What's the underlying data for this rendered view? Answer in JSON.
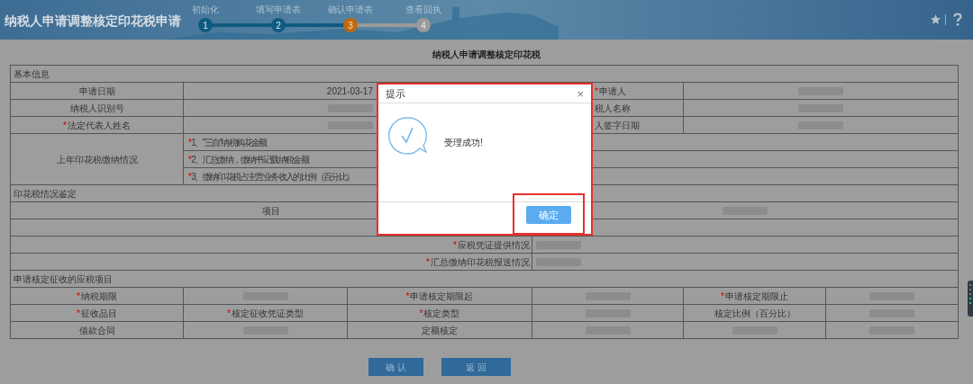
{
  "header": {
    "title": "纳税人申请调整核定印花税申请",
    "steps": [
      {
        "label": "初始化",
        "number": "1",
        "completed": true,
        "selected": false
      },
      {
        "label": "填写申请表",
        "number": "2",
        "completed": true,
        "selected": false
      },
      {
        "label": "确认申请表",
        "number": "3",
        "completed": false,
        "selected": true
      },
      {
        "label": "查看回执",
        "number": "4",
        "completed": false,
        "selected": false
      }
    ]
  },
  "form_title": "纳税人申请调整核定印花税",
  "basic_info": {
    "title": "基本信息",
    "rows": [
      [
        {
          "kind": "label",
          "text": "申请日期"
        },
        {
          "kind": "text",
          "text": "2021-03-17"
        },
        {
          "kind": "label",
          "text": "申请人",
          "marker": "*"
        },
        {
          "kind": "blur"
        }
      ],
      [
        {
          "kind": "label",
          "text": "纳税人识别号"
        },
        {
          "kind": "blur"
        },
        {
          "kind": "label",
          "text": "税人名称"
        },
        {
          "kind": "blur"
        }
      ],
      [
        {
          "kind": "label",
          "text": "法定代表人姓名",
          "marker": "*"
        },
        {
          "kind": "blur"
        },
        {
          "kind": "label",
          "text": "人签字日期"
        },
        {
          "kind": "blur"
        }
      ]
    ],
    "last_year": {
      "label": "上年印花税缴纳情况",
      "items": [
        {
          "text": "1、\"三自\"纳税购花金额",
          "marker": "*"
        },
        {
          "text": "2、汇总缴纳，缴纳书记载纳税金额",
          "marker": "*"
        },
        {
          "text": "3、缴纳印花税占主营业务收入的比例（百分比）",
          "marker": "*"
        }
      ]
    }
  },
  "stamp_tax": {
    "title": "印花税情况鉴定",
    "rows": [
      [
        {
          "kind": "header",
          "text": "项目"
        },
        {
          "kind": "blur"
        }
      ],
      [
        {
          "kind": "empty"
        },
        {
          "kind": "empty"
        }
      ],
      [
        {
          "kind": "label",
          "text": "应税凭证提供情况",
          "marker": "*"
        },
        {
          "kind": "blur"
        }
      ],
      [
        {
          "kind": "label",
          "text": "汇总缴纳印花税报送情况",
          "marker": "*"
        },
        {
          "kind": "blur"
        }
      ]
    ]
  },
  "items": {
    "title": "申请核定征收的应税项目",
    "rows": [
      [
        {
          "kind": "label",
          "text": "纳税期限",
          "marker": "*"
        },
        {
          "kind": "blur"
        },
        {
          "kind": "label",
          "text": "申请核定期限起",
          "marker": "*"
        },
        {
          "kind": "blur"
        },
        {
          "kind": "label",
          "text": "申请核定期限止",
          "marker": "*"
        },
        {
          "kind": "blur"
        }
      ],
      [
        {
          "kind": "label",
          "text": "征收品目",
          "marker": "*"
        },
        {
          "kind": "label",
          "text": "核定征收凭证类型",
          "marker": "*"
        },
        {
          "kind": "label",
          "text": "核定类型",
          "marker": "*"
        },
        {
          "kind": "blur"
        },
        {
          "kind": "label",
          "text": "核定比例（百分比）"
        },
        {
          "kind": "blur"
        }
      ],
      [
        {
          "kind": "label",
          "text": "借款合同"
        },
        {
          "kind": "blur"
        },
        {
          "kind": "label",
          "text": "定额核定"
        },
        {
          "kind": "blur"
        },
        {
          "kind": "blur"
        },
        {
          "kind": "blur"
        }
      ]
    ]
  },
  "buttons": [
    "确 认",
    "返 回"
  ],
  "dialog": {
    "title": "提示",
    "close": "×",
    "message": "受理成功!",
    "button": "确定"
  }
}
